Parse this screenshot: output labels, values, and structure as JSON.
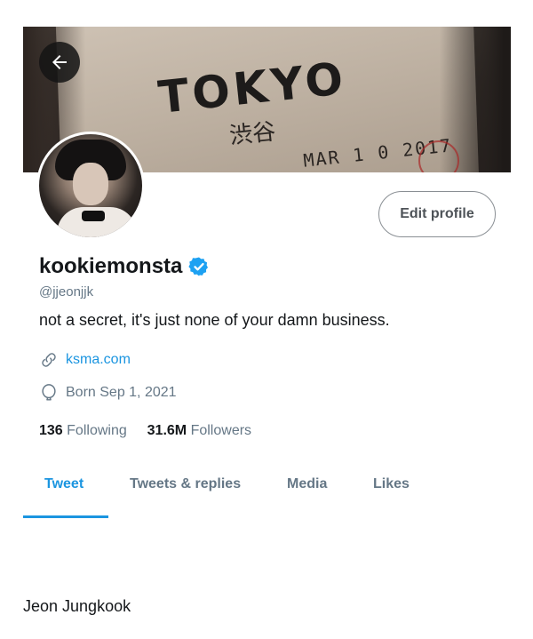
{
  "banner": {
    "stamp_main": "TOKYO",
    "stamp_jp": "渋谷",
    "stamp_date": "MAR 1 0 2017"
  },
  "header": {
    "back_icon": "arrow-left-icon",
    "edit_label": "Edit profile"
  },
  "profile": {
    "display_name": "kookiemonsta",
    "handle": "@jjeonjjk",
    "bio": "not a secret, it's just none of your damn business.",
    "link": "ksma.com",
    "born": "Born Sep 1, 2021",
    "following_count": "136",
    "following_label": "Following",
    "followers_count": "31.6M",
    "followers_label": "Followers"
  },
  "tabs": [
    {
      "label": "Tweet",
      "active": true
    },
    {
      "label": "Tweets & replies",
      "active": false
    },
    {
      "label": "Media",
      "active": false
    },
    {
      "label": "Likes",
      "active": false
    }
  ],
  "footer_text": "Jeon Jungkook",
  "colors": {
    "accent": "#1b95e0",
    "secondary_text": "#657786",
    "verified": "#1da1f2"
  }
}
